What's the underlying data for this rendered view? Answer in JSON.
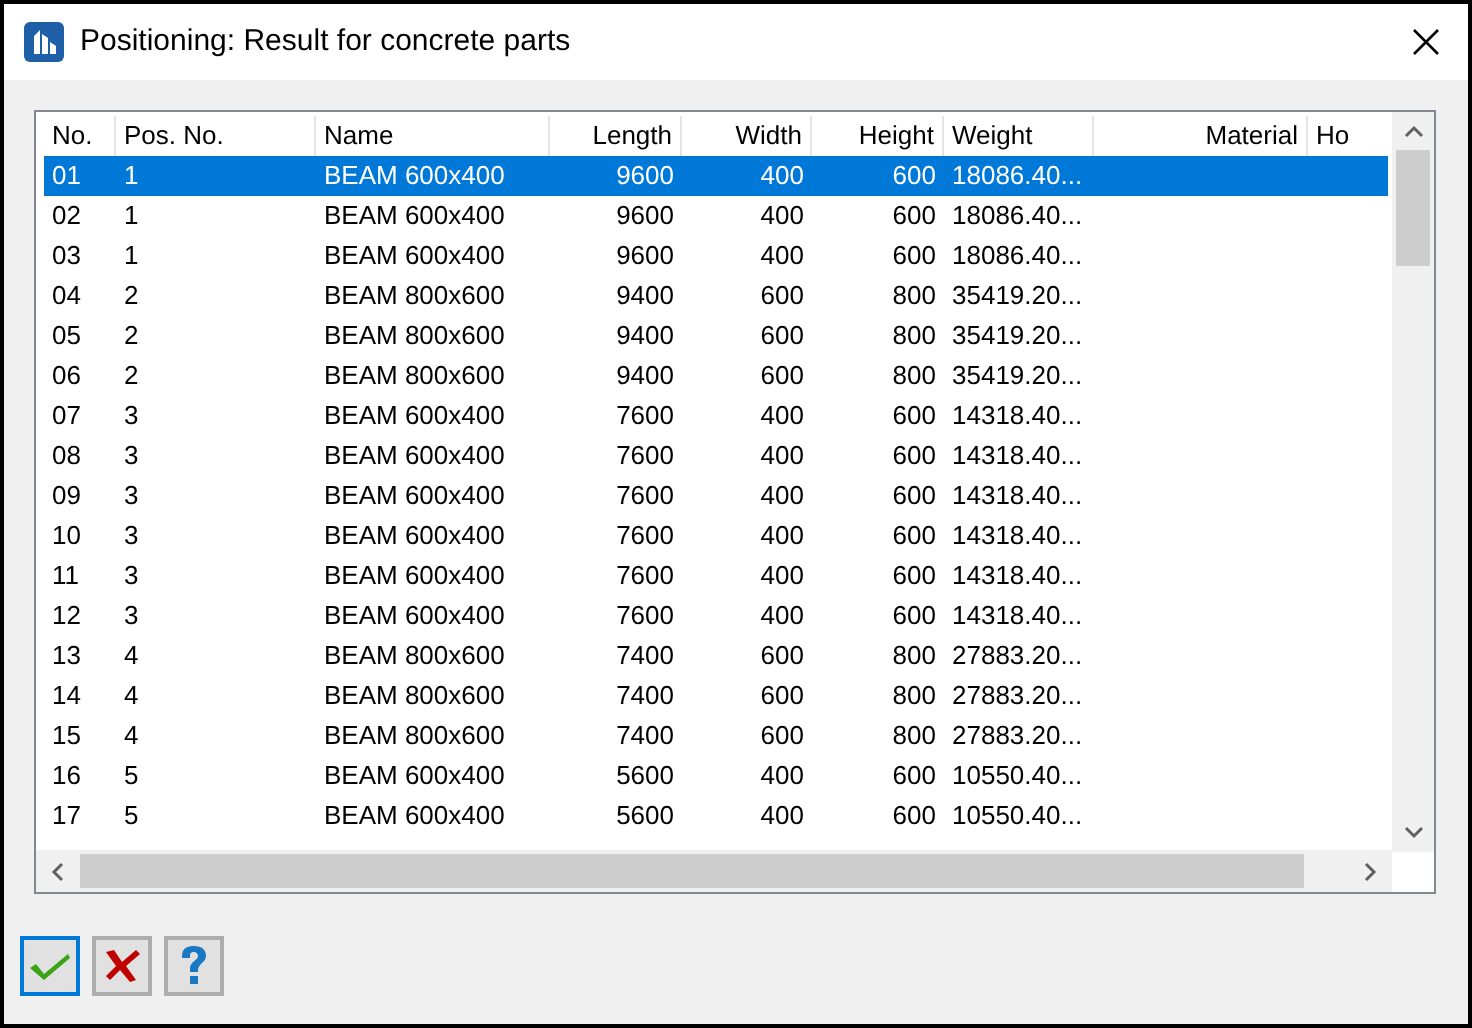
{
  "window": {
    "title": "Positioning: Result for concrete parts"
  },
  "table": {
    "columns": [
      {
        "label": "No."
      },
      {
        "label": "Pos. No."
      },
      {
        "label": "Name"
      },
      {
        "label": "Length"
      },
      {
        "label": "Width"
      },
      {
        "label": "Height"
      },
      {
        "label": "Weight"
      },
      {
        "label": "Material"
      },
      {
        "label": "Ho"
      }
    ],
    "rows": [
      {
        "selected": true,
        "cells": [
          "01",
          "1",
          "BEAM 600x400",
          "9600",
          "400",
          "600",
          "18086.40..."
        ]
      },
      {
        "selected": false,
        "cells": [
          "02",
          "1",
          "BEAM 600x400",
          "9600",
          "400",
          "600",
          "18086.40..."
        ]
      },
      {
        "selected": false,
        "cells": [
          "03",
          "1",
          "BEAM 600x400",
          "9600",
          "400",
          "600",
          "18086.40..."
        ]
      },
      {
        "selected": false,
        "cells": [
          "04",
          "2",
          "BEAM 800x600",
          "9400",
          "600",
          "800",
          "35419.20..."
        ]
      },
      {
        "selected": false,
        "cells": [
          "05",
          "2",
          "BEAM 800x600",
          "9400",
          "600",
          "800",
          "35419.20..."
        ]
      },
      {
        "selected": false,
        "cells": [
          "06",
          "2",
          "BEAM 800x600",
          "9400",
          "600",
          "800",
          "35419.20..."
        ]
      },
      {
        "selected": false,
        "cells": [
          "07",
          "3",
          "BEAM 600x400",
          "7600",
          "400",
          "600",
          "14318.40..."
        ]
      },
      {
        "selected": false,
        "cells": [
          "08",
          "3",
          "BEAM 600x400",
          "7600",
          "400",
          "600",
          "14318.40..."
        ]
      },
      {
        "selected": false,
        "cells": [
          "09",
          "3",
          "BEAM 600x400",
          "7600",
          "400",
          "600",
          "14318.40..."
        ]
      },
      {
        "selected": false,
        "cells": [
          "10",
          "3",
          "BEAM 600x400",
          "7600",
          "400",
          "600",
          "14318.40..."
        ]
      },
      {
        "selected": false,
        "cells": [
          "11",
          "3",
          "BEAM 600x400",
          "7600",
          "400",
          "600",
          "14318.40..."
        ]
      },
      {
        "selected": false,
        "cells": [
          "12",
          "3",
          "BEAM 600x400",
          "7600",
          "400",
          "600",
          "14318.40..."
        ]
      },
      {
        "selected": false,
        "cells": [
          "13",
          "4",
          "BEAM 800x600",
          "7400",
          "600",
          "800",
          "27883.20..."
        ]
      },
      {
        "selected": false,
        "cells": [
          "14",
          "4",
          "BEAM 800x600",
          "7400",
          "600",
          "800",
          "27883.20..."
        ]
      },
      {
        "selected": false,
        "cells": [
          "15",
          "4",
          "BEAM 800x600",
          "7400",
          "600",
          "800",
          "27883.20..."
        ]
      },
      {
        "selected": false,
        "cells": [
          "16",
          "5",
          "BEAM 600x400",
          "5600",
          "400",
          "600",
          "10550.40..."
        ]
      },
      {
        "selected": false,
        "cells": [
          "17",
          "5",
          "BEAM 600x400",
          "5600",
          "400",
          "600",
          "10550.40..."
        ]
      }
    ]
  },
  "buttons": [
    {
      "kind": "ok"
    },
    {
      "kind": "cancel"
    },
    {
      "kind": "help"
    }
  ]
}
